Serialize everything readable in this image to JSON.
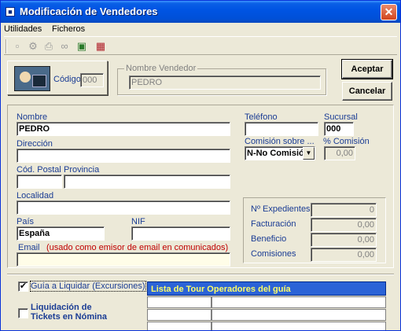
{
  "window": {
    "title": "Modificación de Vendedores",
    "close_glyph": "✕",
    "app_icon": "app-icon"
  },
  "menu": {
    "items": [
      "Utilidades",
      "Ficheros"
    ]
  },
  "toolbar": {
    "icons": [
      "save-icon",
      "settings-icon",
      "print-icon",
      "binoculars-icon",
      "import-icon",
      "chart-icon"
    ]
  },
  "header": {
    "codigo_label": "Código",
    "codigo_value": "000",
    "nombre_vendedor_label": "Nombre Vendedor",
    "nombre_vendedor_value": "PEDRO"
  },
  "buttons": {
    "aceptar": "Aceptar",
    "cancelar": "Cancelar"
  },
  "form": {
    "nombre_label": "Nombre",
    "nombre_value": "PEDRO",
    "direccion_label": "Dirección",
    "direccion_value": "",
    "cod_postal_label": "Cód. Postal",
    "cod_postal_value": "",
    "provincia_label": "Provincia",
    "provincia_value": "",
    "localidad_label": "Localidad",
    "localidad_value": "",
    "pais_label": "País",
    "pais_value": "España",
    "nif_label": "NIF",
    "nif_value": "",
    "email_label": "Email",
    "email_note": "(usado como emisor de email en comunicados)",
    "email_value": "",
    "telefono_label": "Teléfono",
    "telefono_value": "",
    "sucursal_label": "Sucursal",
    "sucursal_value": "000",
    "comision_sobre_label": "Comisión sobre ...",
    "comision_sobre_value": "N-No Comisiór",
    "pct_comision_label": "% Comisión",
    "pct_comision_value": "0,00"
  },
  "stats": {
    "expedientes_label": "Nº Expedientes",
    "expedientes_value": "0",
    "facturacion_label": "Facturación",
    "facturacion_value": "0,00",
    "beneficio_label": "Beneficio",
    "beneficio_value": "0,00",
    "comisiones_label": "Comisiones",
    "comisiones_value": "0,00"
  },
  "bottom": {
    "guia_label": "Guía a Liquidar (Excursiones)",
    "guia_checked": "✔",
    "liquidacion_label_1": "Liquidación de",
    "liquidacion_label_2": "Tickets en Nómina",
    "tour_list_title": "Lista de Tour Operadores del guía"
  }
}
